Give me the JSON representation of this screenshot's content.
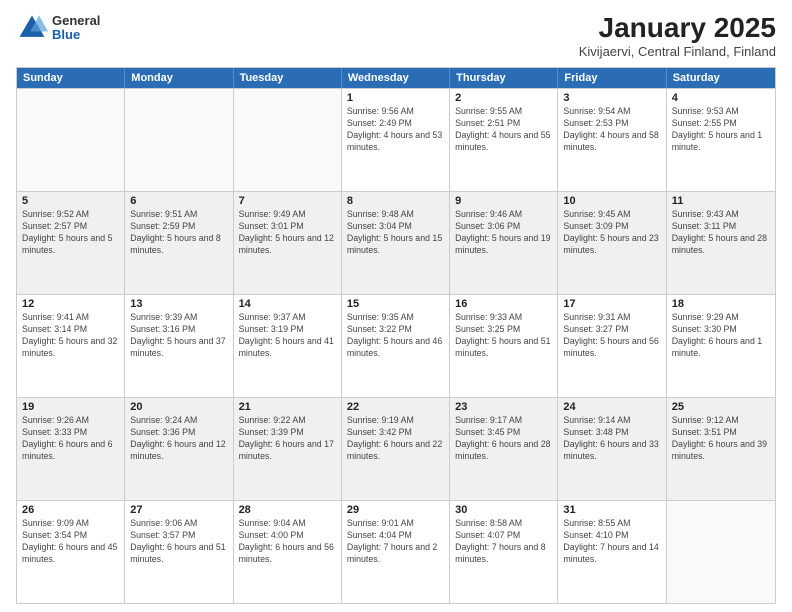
{
  "header": {
    "logo_general": "General",
    "logo_blue": "Blue",
    "main_title": "January 2025",
    "subtitle": "Kivijaervi, Central Finland, Finland"
  },
  "weekdays": [
    "Sunday",
    "Monday",
    "Tuesday",
    "Wednesday",
    "Thursday",
    "Friday",
    "Saturday"
  ],
  "rows": [
    [
      {
        "day": "",
        "text": ""
      },
      {
        "day": "",
        "text": ""
      },
      {
        "day": "",
        "text": ""
      },
      {
        "day": "1",
        "text": "Sunrise: 9:56 AM\nSunset: 2:49 PM\nDaylight: 4 hours and 53 minutes."
      },
      {
        "day": "2",
        "text": "Sunrise: 9:55 AM\nSunset: 2:51 PM\nDaylight: 4 hours and 55 minutes."
      },
      {
        "day": "3",
        "text": "Sunrise: 9:54 AM\nSunset: 2:53 PM\nDaylight: 4 hours and 58 minutes."
      },
      {
        "day": "4",
        "text": "Sunrise: 9:53 AM\nSunset: 2:55 PM\nDaylight: 5 hours and 1 minute."
      }
    ],
    [
      {
        "day": "5",
        "text": "Sunrise: 9:52 AM\nSunset: 2:57 PM\nDaylight: 5 hours and 5 minutes."
      },
      {
        "day": "6",
        "text": "Sunrise: 9:51 AM\nSunset: 2:59 PM\nDaylight: 5 hours and 8 minutes."
      },
      {
        "day": "7",
        "text": "Sunrise: 9:49 AM\nSunset: 3:01 PM\nDaylight: 5 hours and 12 minutes."
      },
      {
        "day": "8",
        "text": "Sunrise: 9:48 AM\nSunset: 3:04 PM\nDaylight: 5 hours and 15 minutes."
      },
      {
        "day": "9",
        "text": "Sunrise: 9:46 AM\nSunset: 3:06 PM\nDaylight: 5 hours and 19 minutes."
      },
      {
        "day": "10",
        "text": "Sunrise: 9:45 AM\nSunset: 3:09 PM\nDaylight: 5 hours and 23 minutes."
      },
      {
        "day": "11",
        "text": "Sunrise: 9:43 AM\nSunset: 3:11 PM\nDaylight: 5 hours and 28 minutes."
      }
    ],
    [
      {
        "day": "12",
        "text": "Sunrise: 9:41 AM\nSunset: 3:14 PM\nDaylight: 5 hours and 32 minutes."
      },
      {
        "day": "13",
        "text": "Sunrise: 9:39 AM\nSunset: 3:16 PM\nDaylight: 5 hours and 37 minutes."
      },
      {
        "day": "14",
        "text": "Sunrise: 9:37 AM\nSunset: 3:19 PM\nDaylight: 5 hours and 41 minutes."
      },
      {
        "day": "15",
        "text": "Sunrise: 9:35 AM\nSunset: 3:22 PM\nDaylight: 5 hours and 46 minutes."
      },
      {
        "day": "16",
        "text": "Sunrise: 9:33 AM\nSunset: 3:25 PM\nDaylight: 5 hours and 51 minutes."
      },
      {
        "day": "17",
        "text": "Sunrise: 9:31 AM\nSunset: 3:27 PM\nDaylight: 5 hours and 56 minutes."
      },
      {
        "day": "18",
        "text": "Sunrise: 9:29 AM\nSunset: 3:30 PM\nDaylight: 6 hours and 1 minute."
      }
    ],
    [
      {
        "day": "19",
        "text": "Sunrise: 9:26 AM\nSunset: 3:33 PM\nDaylight: 6 hours and 6 minutes."
      },
      {
        "day": "20",
        "text": "Sunrise: 9:24 AM\nSunset: 3:36 PM\nDaylight: 6 hours and 12 minutes."
      },
      {
        "day": "21",
        "text": "Sunrise: 9:22 AM\nSunset: 3:39 PM\nDaylight: 6 hours and 17 minutes."
      },
      {
        "day": "22",
        "text": "Sunrise: 9:19 AM\nSunset: 3:42 PM\nDaylight: 6 hours and 22 minutes."
      },
      {
        "day": "23",
        "text": "Sunrise: 9:17 AM\nSunset: 3:45 PM\nDaylight: 6 hours and 28 minutes."
      },
      {
        "day": "24",
        "text": "Sunrise: 9:14 AM\nSunset: 3:48 PM\nDaylight: 6 hours and 33 minutes."
      },
      {
        "day": "25",
        "text": "Sunrise: 9:12 AM\nSunset: 3:51 PM\nDaylight: 6 hours and 39 minutes."
      }
    ],
    [
      {
        "day": "26",
        "text": "Sunrise: 9:09 AM\nSunset: 3:54 PM\nDaylight: 6 hours and 45 minutes."
      },
      {
        "day": "27",
        "text": "Sunrise: 9:06 AM\nSunset: 3:57 PM\nDaylight: 6 hours and 51 minutes."
      },
      {
        "day": "28",
        "text": "Sunrise: 9:04 AM\nSunset: 4:00 PM\nDaylight: 6 hours and 56 minutes."
      },
      {
        "day": "29",
        "text": "Sunrise: 9:01 AM\nSunset: 4:04 PM\nDaylight: 7 hours and 2 minutes."
      },
      {
        "day": "30",
        "text": "Sunrise: 8:58 AM\nSunset: 4:07 PM\nDaylight: 7 hours and 8 minutes."
      },
      {
        "day": "31",
        "text": "Sunrise: 8:55 AM\nSunset: 4:10 PM\nDaylight: 7 hours and 14 minutes."
      },
      {
        "day": "",
        "text": ""
      }
    ]
  ]
}
